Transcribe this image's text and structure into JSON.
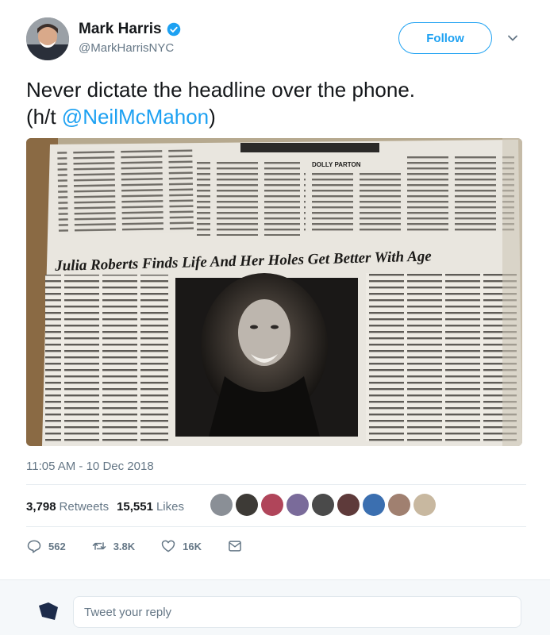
{
  "author": {
    "name": "Mark Harris",
    "handle": "@MarkHarrisNYC",
    "verified": true
  },
  "follow_label": "Follow",
  "tweet": {
    "text_line1": "Never dictate the headline over the phone.",
    "text_prefix": "(h/t ",
    "mention": "@NeilMcMahon",
    "text_suffix": ")"
  },
  "photo": {
    "section_label": "DOLLY PARTON",
    "headline": "Julia Roberts Finds Life And Her Holes Get Better With Age"
  },
  "timestamp": "11:05 AM - 10 Dec 2018",
  "stats": {
    "retweets_count": "3,798",
    "retweets_label": "Retweets",
    "likes_count": "15,551",
    "likes_label": "Likes"
  },
  "actions": {
    "replies": "562",
    "retweets": "3.8K",
    "likes": "16K"
  },
  "reply": {
    "placeholder": "Tweet your reply"
  },
  "colors": {
    "accent": "#1da1f2",
    "muted": "#657786",
    "text": "#14171a"
  }
}
